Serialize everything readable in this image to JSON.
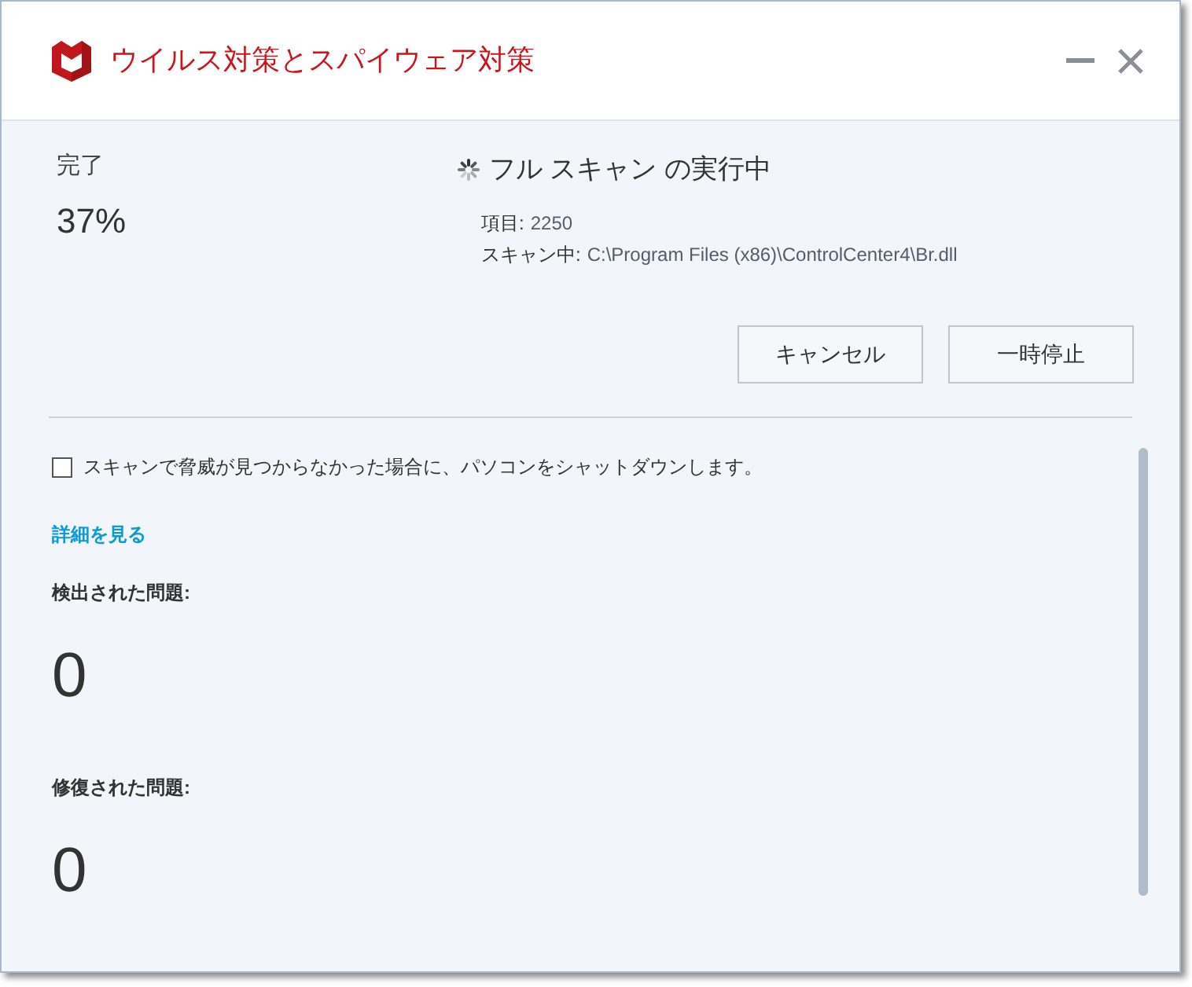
{
  "window": {
    "title": "ウイルス対策とスパイウェア対策"
  },
  "progress": {
    "label": "完了",
    "value": "37%"
  },
  "scan": {
    "title": "フル スキャン の実行中",
    "details": [
      {
        "label": "項目:",
        "value": "2250"
      },
      {
        "label": "スキャン中:",
        "value": "C:\\Program Files (x86)\\ControlCenter4\\Br.dll"
      }
    ]
  },
  "buttons": [
    "キャンセル",
    "一時停止"
  ],
  "shutdown_option": {
    "label": "スキャンで脅威が見つからなかった場合に、パソコンをシャットダウンします。",
    "checked": false
  },
  "details_link": "詳細を見る",
  "results": [
    {
      "label": "検出された問題:",
      "count": "0"
    },
    {
      "label": "修復された問題:",
      "count": "0"
    }
  ]
}
